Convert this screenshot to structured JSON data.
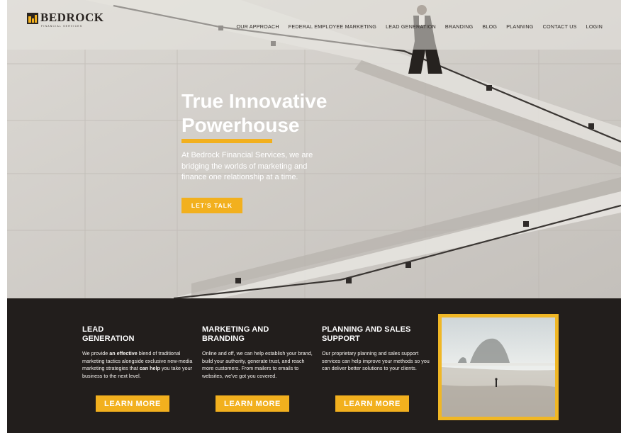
{
  "brand": {
    "name": "BEDROCK",
    "tagline": "FINANCIAL SERVICES",
    "logo_icon": "building-logo-icon"
  },
  "nav": {
    "items": [
      "OUR APPROACH",
      "FEDERAL EMPLOYEE MARKETING",
      "LEAD GENERATION",
      "BRANDING",
      "BLOG",
      "PLANNING",
      "CONTACT US",
      "LOGIN"
    ]
  },
  "hero": {
    "title": "True Innovative Powerhouse",
    "body": "At Bedrock Financial Services, we are bridging the worlds of marketing and finance one relationship at a time.",
    "cta": "LET'S TALK"
  },
  "services": [
    {
      "title_line1": "LEAD",
      "title_line2": "GENERATION",
      "text_1": "We provide ",
      "text_bold_1": "an effective",
      "text_2": " blend of traditional marketing tactics alongside exclusive new-media marketing strategies that ",
      "text_bold_2": "can help",
      "text_3": " you take your business to the next level.",
      "button": "LEARN MORE"
    },
    {
      "title_line1": "MARKETING AND",
      "title_line2": "BRANDING",
      "text_1": "Online and off, we can help establish your brand, build your authority, generate trust, and reach more customers. From mailers to emails to websites, we've got you covered.",
      "button": "LEARN MORE"
    },
    {
      "title_line1": "PLANNING AND SALES",
      "title_line2": "SUPPORT",
      "text_1": "Our proprietary planning and sales support services can help improve your methods so you can deliver better solutions to your clients.",
      "button": "LEARN MORE"
    }
  ],
  "colors": {
    "accent": "#f2b01e",
    "dark": "#221e1c",
    "white": "#ffffff"
  }
}
